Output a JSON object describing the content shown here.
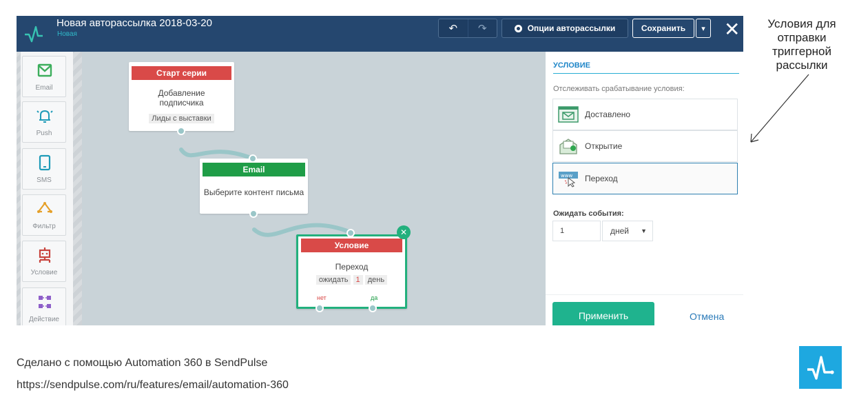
{
  "window": {
    "title": "Новая авторассылка 2018-03-20",
    "status": "Новая",
    "buttons": {
      "options": "Опции авторассылки",
      "save": "Сохранить"
    }
  },
  "sidebar": {
    "items": [
      {
        "label": "Email",
        "icon": "envelope-icon"
      },
      {
        "label": "Push",
        "icon": "bell-icon"
      },
      {
        "label": "SMS",
        "icon": "phone-icon"
      },
      {
        "label": "Фильтр",
        "icon": "filter-icon"
      },
      {
        "label": "Условие",
        "icon": "robot-icon"
      },
      {
        "label": "Действие",
        "icon": "action-icon"
      }
    ]
  },
  "nodes": {
    "start": {
      "header": "Старт серии",
      "text": "Добавление подписчика",
      "chip": "Лиды с выставки"
    },
    "email": {
      "header": "Email",
      "text": "Выберите контент письма"
    },
    "condition": {
      "header": "Условие",
      "text": "Переход",
      "wait_prefix": "ожидать",
      "wait_value": "1",
      "wait_unit": "день",
      "no_label": "нет",
      "yes_label": "да"
    }
  },
  "panel": {
    "title": "УСЛОВИЕ",
    "description": "Отслеживать срабатывание условия:",
    "options": [
      {
        "label": "Доставлено",
        "icon": "delivered-icon"
      },
      {
        "label": "Открытие",
        "icon": "open-icon"
      },
      {
        "label": "Переход",
        "icon": "click-icon",
        "selected": true
      }
    ],
    "wait_label": "Ожидать события:",
    "wait_value": "1",
    "wait_unit": "дней",
    "apply": "Применить",
    "cancel": "Отмена"
  },
  "annotation": "Условия для отправки триггерной рассылки",
  "footer": {
    "line1": "Сделано с помощью Automation 360 в SendPulse",
    "line2": "https://sendpulse.com/ru/features/email/automation-360"
  },
  "colors": {
    "topbar": "#25476f",
    "accent": "#1fb38e",
    "start_header": "#d94a48",
    "email_header": "#1f9d47",
    "condition_header": "#d94a48",
    "brand": "#1ea8e0"
  }
}
